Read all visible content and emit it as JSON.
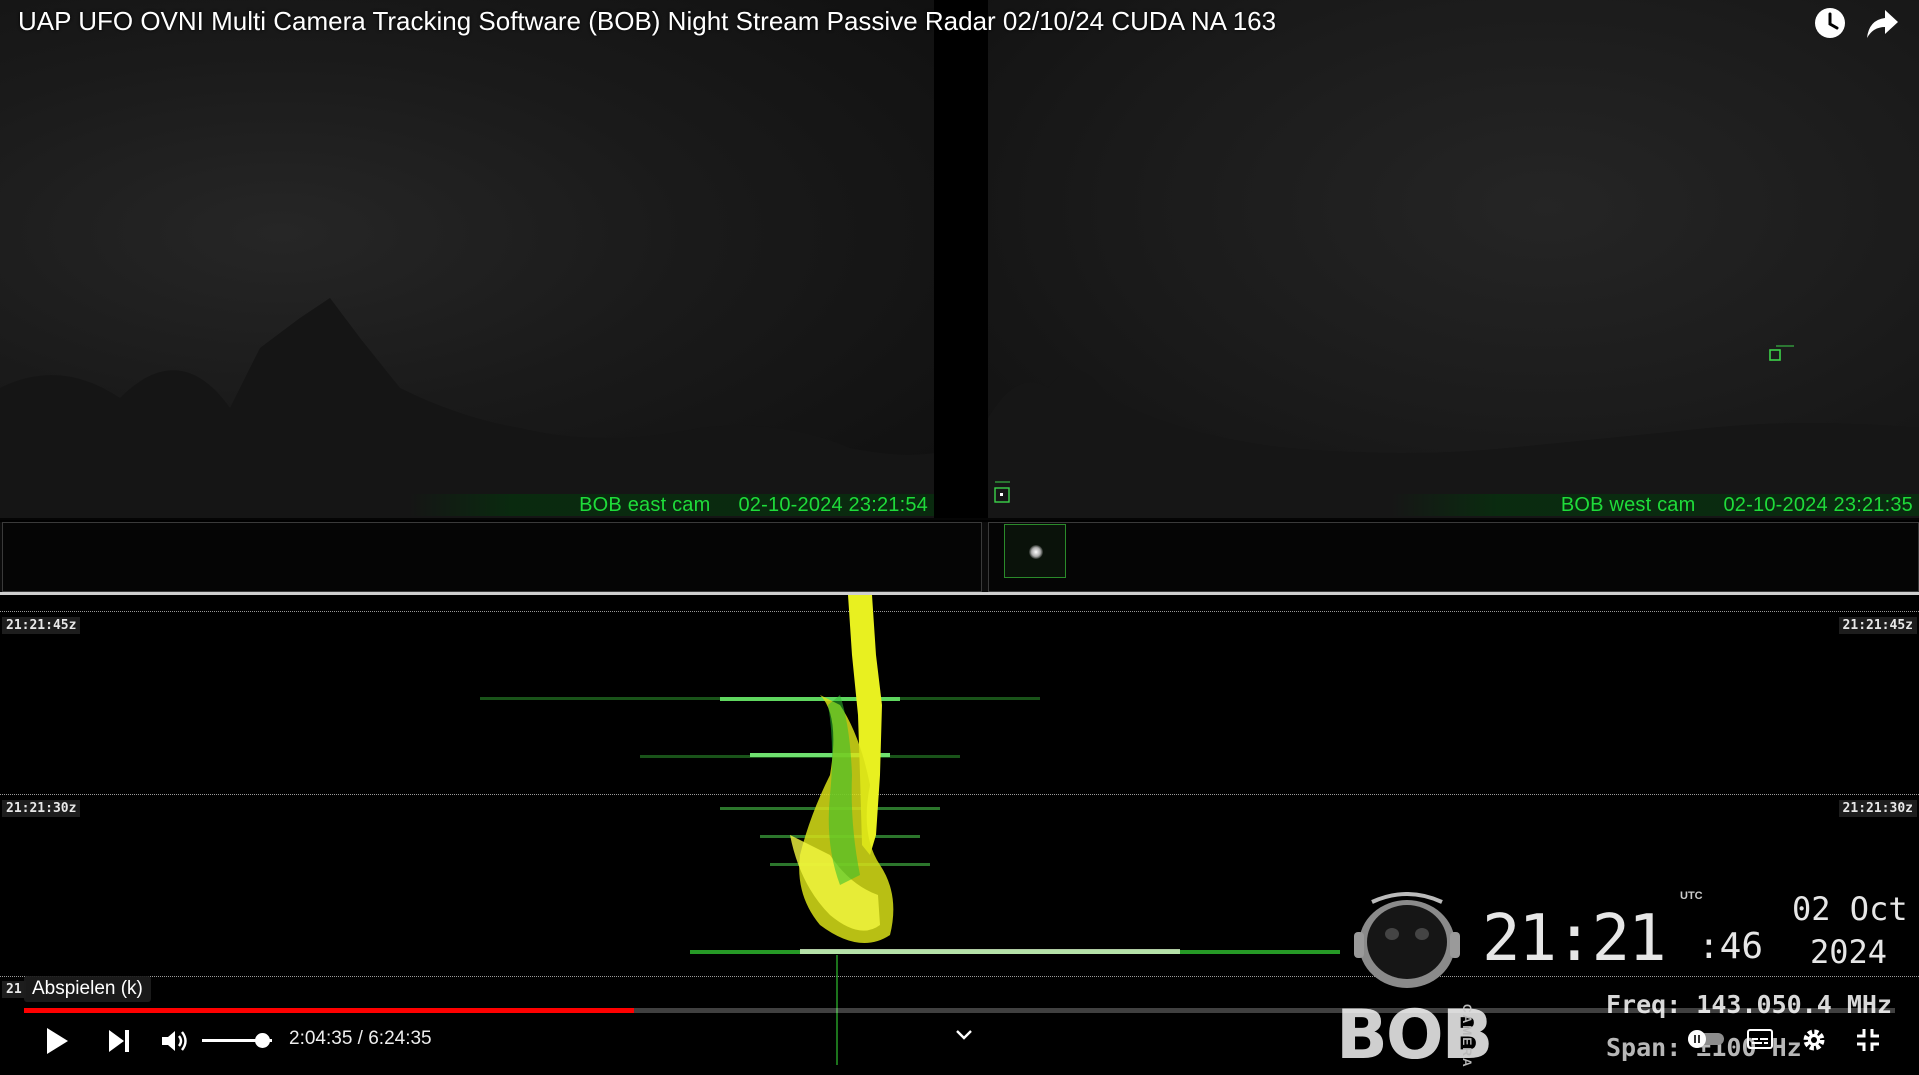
{
  "video": {
    "title": "UAP UFO OVNI Multi Camera Tracking Software (BOB) Night Stream Passive Radar 02/10/24 CUDA NA 163"
  },
  "cameras": {
    "east": {
      "name": "BOB east cam",
      "timestamp": "02-10-2024 23:21:54"
    },
    "west": {
      "name": "BOB west cam",
      "timestamp": "02-10-2024 23:21:35"
    }
  },
  "waterfall": {
    "timestamps": [
      "21:21:45z",
      "21:21:30z"
    ],
    "partial_label": "21"
  },
  "overlay": {
    "utc_label": "UTC",
    "clock_hhmm": "21:21",
    "clock_sec": ":46",
    "date_day": "02 Oct",
    "date_year": "2024",
    "freq": "Freq: 143.050.4 MHz",
    "span": "Span: ±100 Hz",
    "logo_text": "BOB",
    "logo_sub": "CAMERA"
  },
  "player": {
    "tooltip": "Abspielen (k)",
    "time_current": "2:04:35",
    "time_total": "6:24:35",
    "time_display": "2:04:35 / 6:24:35",
    "progress_fraction": 0.326,
    "volume_fraction": 0.85
  },
  "colors": {
    "caption_green": "#1fdc3a",
    "progress_red": "#ff0000",
    "signal_yellow": "#e8f020",
    "signal_green": "#2fbf2f"
  },
  "icons": [
    "watch-later-icon",
    "share-icon",
    "play-icon",
    "next-icon",
    "volume-icon",
    "chevron-down-icon",
    "autoplay-toggle-icon",
    "subtitles-icon",
    "settings-icon",
    "exit-fullscreen-icon"
  ]
}
